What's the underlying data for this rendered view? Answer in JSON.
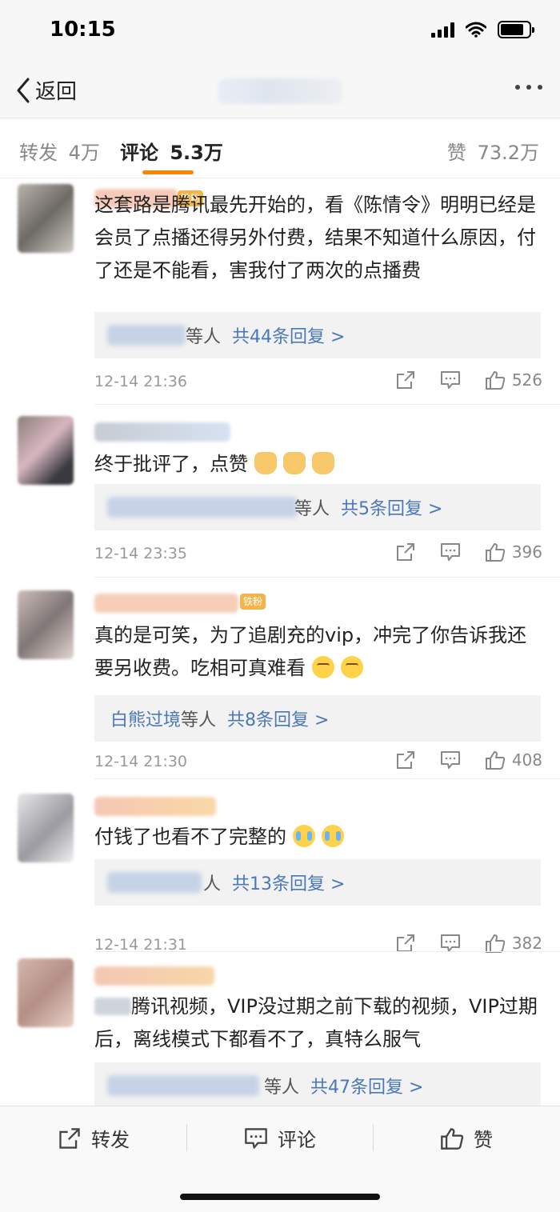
{
  "status_bar": {
    "time": "10:15"
  },
  "nav": {
    "back_label": "返回"
  },
  "tabs": {
    "repost": {
      "label": "转发",
      "count": "4万"
    },
    "comment": {
      "label": "评论",
      "count": "5.3万"
    },
    "likes": {
      "label": "赞",
      "count": "73.2万"
    }
  },
  "comments": [
    {
      "badge": "铁粉",
      "text": "这套路是腾讯最先开始的，看《陈情令》明明已经是会员了点播还得另外付费，结果不知道什么原因，付了还是不能看，害我付了两次的点播费",
      "reply_suffix": "等人",
      "reply_count": "共44条回复 >",
      "time": "12-14 21:36",
      "likes": "526"
    },
    {
      "text": "终于批评了，点赞",
      "reply_suffix": "等人",
      "reply_count": "共5条回复 >",
      "time": "12-14 23:35",
      "likes": "396"
    },
    {
      "badge": "铁粉",
      "text": "真的是可笑，为了追剧充的vip，冲完了你告诉我还要另收费。吃相可真难看",
      "replier": "白熊过境",
      "reply_suffix": "等人",
      "reply_count": "共8条回复 >",
      "time": "12-14 21:30",
      "likes": "408"
    },
    {
      "text": "付钱了也看不了完整的",
      "reply_suffix": "人",
      "reply_count": "共13条回复 >",
      "time": "12-14 21:31",
      "likes": "382"
    },
    {
      "text": "腾讯视频，VIP没过期之前下载的视频，VIP过期后，离线模式下都看不了，真特么服气",
      "reply_suffix": "等人",
      "reply_count": "共47条回复 >"
    }
  ],
  "bottom_bar": {
    "repost": "转发",
    "comment": "评论",
    "like": "赞"
  },
  "colors": {
    "accent": "#ff8200",
    "link": "#4a78b8"
  },
  "icons": [
    "share-icon",
    "comment-icon",
    "like-icon"
  ]
}
